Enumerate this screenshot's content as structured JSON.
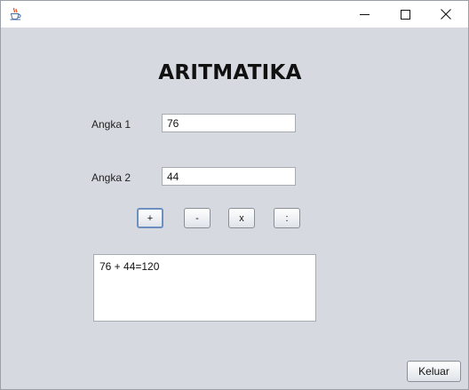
{
  "window": {
    "app_icon": "java-cup-icon",
    "controls": {
      "minimize_icon": "minimize-icon",
      "maximize_icon": "maximize-icon",
      "close_icon": "close-icon"
    }
  },
  "form": {
    "title": "ARITMATIKA",
    "angka1_label": "Angka 1",
    "angka1_value": "76",
    "angka2_label": "Angka 2",
    "angka2_value": "44",
    "operators": {
      "add": "+",
      "subtract": "-",
      "multiply": "x",
      "divide": ":"
    },
    "result": "76 + 44=120",
    "exit_label": "Keluar"
  },
  "colors": {
    "background": "#d6d9e0",
    "titlebar": "#ffffff",
    "focused_border": "#6d8fbf"
  }
}
